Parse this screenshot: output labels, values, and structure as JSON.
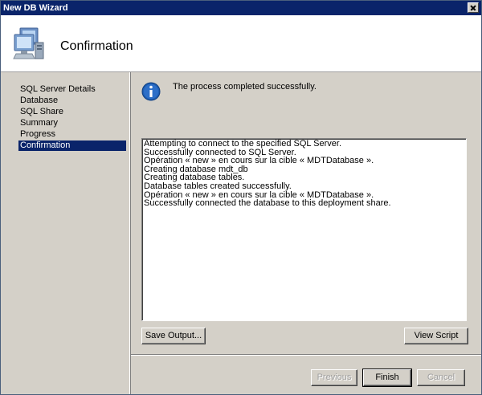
{
  "window": {
    "title": "New DB Wizard"
  },
  "header": {
    "title": "Confirmation"
  },
  "sidebar": {
    "items": [
      {
        "label": "SQL Server Details"
      },
      {
        "label": "Database"
      },
      {
        "label": "SQL Share"
      },
      {
        "label": "Summary"
      },
      {
        "label": "Progress"
      },
      {
        "label": "Confirmation",
        "selected": true
      }
    ]
  },
  "status": {
    "message": "The process completed successfully."
  },
  "log": {
    "lines": [
      "Attempting to connect to the specified SQL Server.",
      "Successfully connected to SQL Server.",
      "Opération « new » en cours sur la cible « MDTDatabase ».",
      "Creating database mdt_db",
      "Creating database tables.",
      "Database tables created successfully.",
      "Opération « new » en cours sur la cible « MDTDatabase ».",
      "Successfully connected the database to this deployment share."
    ]
  },
  "buttons": {
    "save_output": "Save Output...",
    "view_script": "View Script",
    "previous": "Previous",
    "finish": "Finish",
    "cancel": "Cancel"
  },
  "colors": {
    "title_bar": "#0a246a",
    "selected": "#0a246a",
    "info_icon": "#1f5fb4"
  },
  "icons": {
    "header": "computer-network-icon",
    "status": "info-icon",
    "close": "close-icon"
  }
}
